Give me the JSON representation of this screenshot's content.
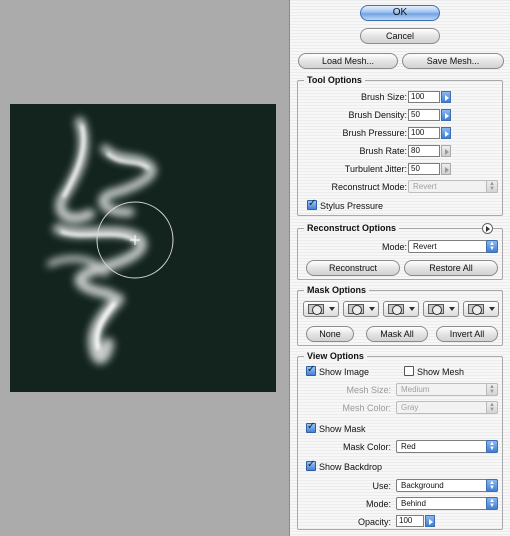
{
  "dialog": {
    "ok_label": "OK",
    "cancel_label": "Cancel",
    "load_mesh_label": "Load Mesh...",
    "save_mesh_label": "Save Mesh..."
  },
  "tool_options": {
    "title": "Tool Options",
    "brush_size": {
      "label": "Brush Size:",
      "value": "100"
    },
    "brush_density": {
      "label": "Brush Density:",
      "value": "50"
    },
    "brush_pressure": {
      "label": "Brush Pressure:",
      "value": "100"
    },
    "brush_rate": {
      "label": "Brush Rate:",
      "value": "80"
    },
    "turbulent_jitter": {
      "label": "Turbulent Jitter:",
      "value": "50"
    },
    "reconstruct_mode": {
      "label": "Reconstruct Mode:",
      "value": "Revert"
    },
    "stylus_pressure": {
      "label": "Stylus Pressure",
      "checked": true
    }
  },
  "reconstruct_options": {
    "title": "Reconstruct Options",
    "mode_label": "Mode:",
    "mode_value": "Revert",
    "reconstruct_label": "Reconstruct",
    "restore_all_label": "Restore All"
  },
  "mask_options": {
    "title": "Mask Options",
    "none_label": "None",
    "mask_all_label": "Mask All",
    "invert_all_label": "Invert All"
  },
  "view_options": {
    "title": "View Options",
    "show_image": {
      "label": "Show Image",
      "checked": true
    },
    "show_mesh": {
      "label": "Show Mesh",
      "checked": false
    },
    "mesh_size": {
      "label": "Mesh Size:",
      "value": "Medium"
    },
    "mesh_color": {
      "label": "Mesh Color:",
      "value": "Gray"
    },
    "show_mask": {
      "label": "Show Mask",
      "checked": true
    },
    "mask_color": {
      "label": "Mask Color:",
      "value": "Red"
    },
    "show_backdrop": {
      "label": "Show Backdrop",
      "checked": true
    },
    "use": {
      "label": "Use:",
      "value": "Background"
    },
    "mode": {
      "label": "Mode:",
      "value": "Behind"
    },
    "opacity": {
      "label": "Opacity:",
      "value": "100"
    }
  },
  "colors": {
    "canvas_bg": "#13241f",
    "accent": "#4a86d8"
  }
}
